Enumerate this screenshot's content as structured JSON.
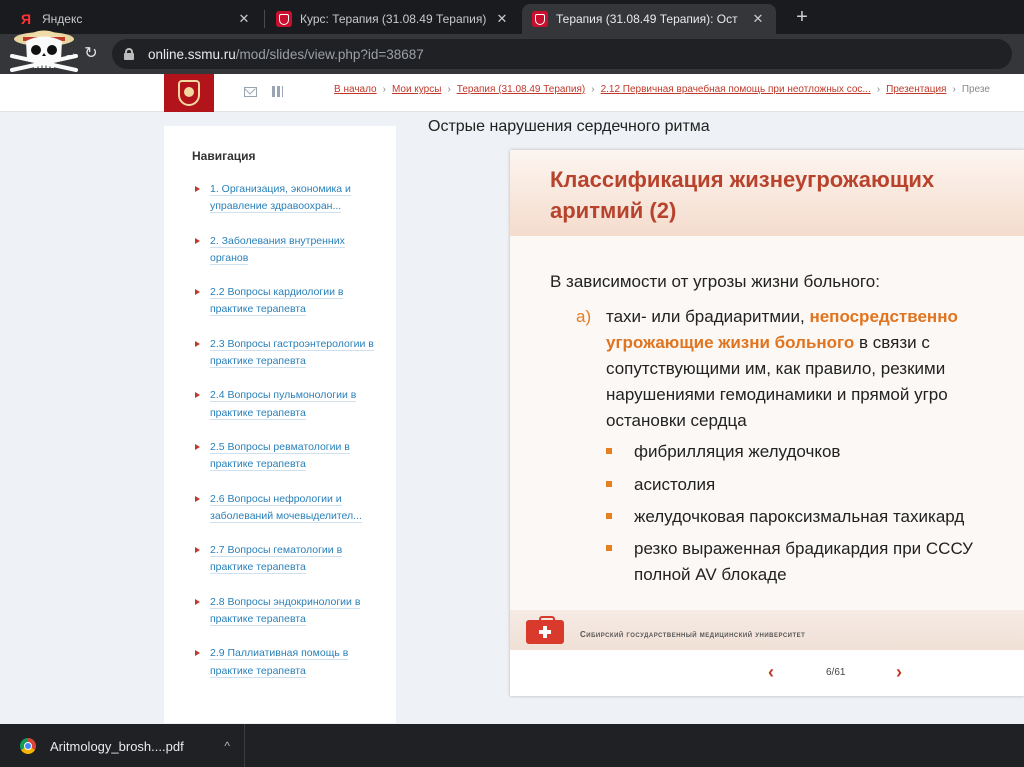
{
  "browser": {
    "tabs": [
      {
        "title": "Яндекс",
        "favicon": "yandex-icon",
        "active": false
      },
      {
        "title": "Курс: Терапия (31.08.49 Терапия)",
        "favicon": "crest-icon",
        "active": false
      },
      {
        "title": "Терапия (31.08.49 Терапия): Ост",
        "favicon": "crest-icon",
        "active": true
      }
    ],
    "new_tab_label": "+",
    "close_glyph": "✕",
    "url_host": "online.ssmu.ru",
    "url_path": "/mod/slides/view.php?id=38687"
  },
  "site": {
    "breadcrumb": [
      "В начало",
      "Мои курсы",
      "Терапия (31.08.49 Терапия)",
      "2.12 Первичная врачебная помощь при неотложных сос...",
      "Презентация",
      "Презе"
    ],
    "breadcrumb_sep": "›"
  },
  "navigation": {
    "heading": "Навигация",
    "items": [
      {
        "label": "1. Организация, экономика и управление здравоохран..."
      },
      {
        "label": "2. Заболевания внутренних органов"
      },
      {
        "label": "2.2 Вопросы кардиологии в практике терапевта"
      },
      {
        "label": "2.3 Вопросы гастроэнтерологии в практике терапевта"
      },
      {
        "label": "2.4 Вопросы пульмонологии в практике терапевта"
      },
      {
        "label": "2.5 Вопросы ревматологии в практике терапевта"
      },
      {
        "label": "2.6 Вопросы нефрологии и заболеваний мочевыделител..."
      },
      {
        "label": "2.7 Вопросы гематологии в практике терапевта"
      },
      {
        "label": "2.8 Вопросы эндокринологии в практике терапевта"
      },
      {
        "label": "2.9 Паллиативная помощь в практике терапевта"
      }
    ]
  },
  "main": {
    "title": "Острые нарушения сердечного ритма",
    "slide": {
      "title_line1": "Классификация жизнеугрожающих",
      "title_line2": "аритмий (2)",
      "lead": "В зависимости от угрозы жизни больного:",
      "item_marker": "а)",
      "item_line1_plain": "тахи- или брадиаритмии, ",
      "item_line1_hl": "непосредственно",
      "item_line2_hl": "угрожающие жизни больного",
      "item_line2_plain": " в связи с",
      "item_line3": "сопутствующими им, как правило, резкими",
      "item_line4": "нарушениями гемодинамики и прямой угро",
      "item_line5": "остановки сердца",
      "subitems": [
        "фибрилляция желудочков",
        "асистолия",
        "желудочковая пароксизмальная тахикард",
        "резко выраженная брадикардия при СССУ"
      ],
      "subitem4_line2": "полной AV блокаде",
      "footer_org": "Сибирский государственный медицинский университет"
    },
    "pager": {
      "prev": "‹",
      "page": "6/61",
      "next": "›"
    }
  },
  "downloads": {
    "file": "Aritmology_brosh....pdf",
    "chevron": "^"
  }
}
